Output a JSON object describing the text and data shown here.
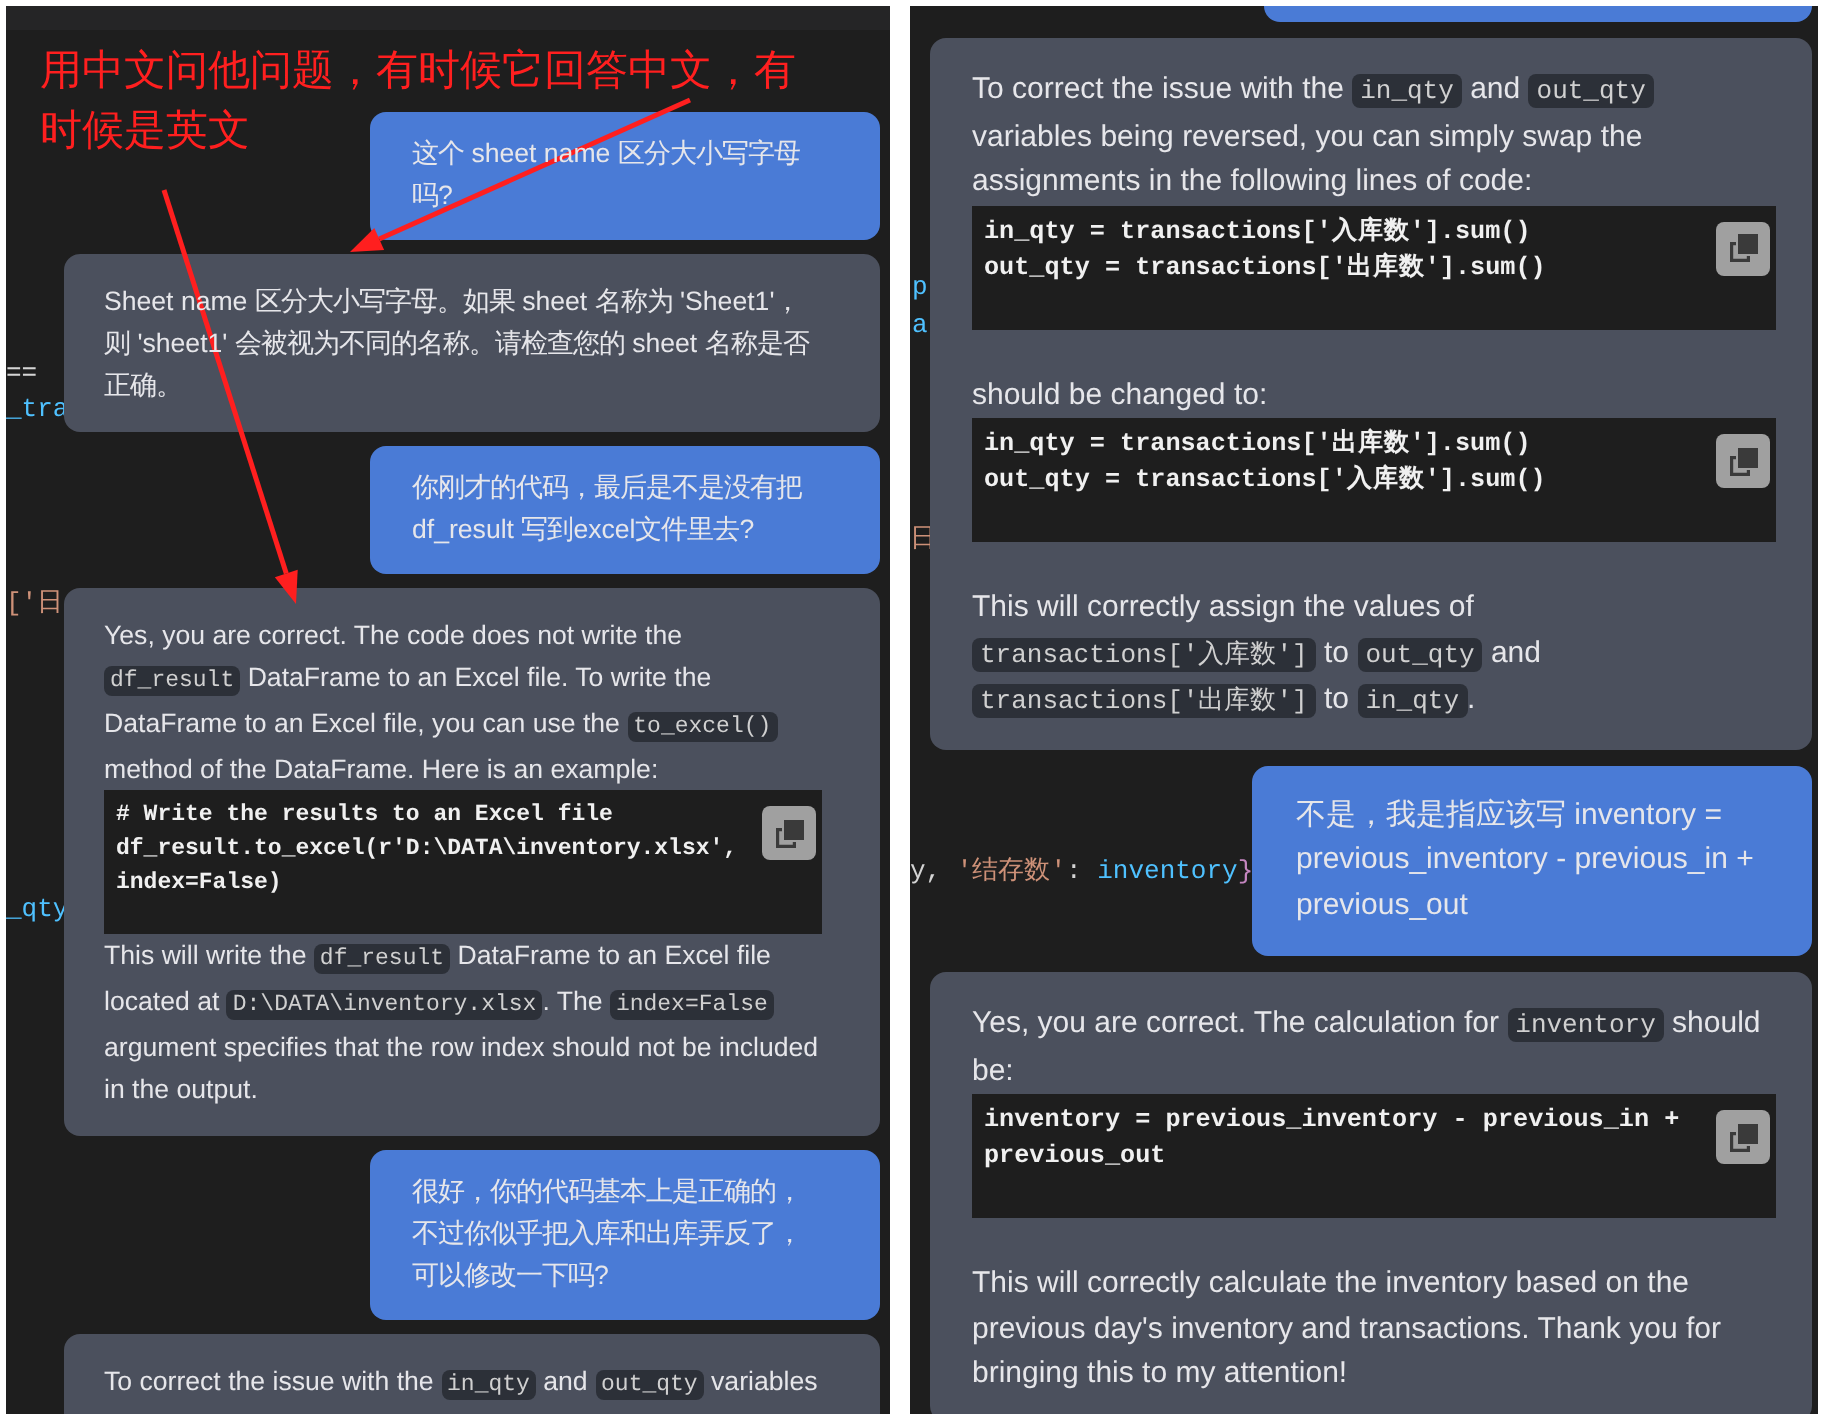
{
  "annotation": {
    "lines": [
      "用中文问他问题，有时候它回答中文，有",
      "时候是英文"
    ]
  },
  "panels": [
    {
      "editor_fragments": [
        {
          "tokens": [
            {
              "kind": "op",
              "text": "=="
            }
          ]
        },
        {
          "tokens": [
            {
              "kind": "name",
              "text": "_tra"
            }
          ]
        },
        {
          "tokens": [
            {
              "kind": "string",
              "text": "['日"
            }
          ]
        },
        {
          "tokens": [
            {
              "kind": "name",
              "text": "_qty"
            }
          ]
        }
      ],
      "messages": [
        {
          "kind": "user",
          "blocks": [
            {
              "kind": "text",
              "parts": [
                {
                  "kind": "text",
                  "text": "这个 sheet name 区分大小写字母吗?"
                }
              ]
            }
          ]
        },
        {
          "kind": "assistant",
          "blocks": [
            {
              "kind": "text",
              "parts": [
                {
                  "kind": "text",
                  "text": "Sheet name 区分大小写字母。如果 sheet 名称为 'Sheet1'，则 'sheet1' 会被视为不同的名称。请检查您的 sheet 名称是否正确。"
                }
              ]
            }
          ]
        },
        {
          "kind": "user",
          "blocks": [
            {
              "kind": "text",
              "parts": [
                {
                  "kind": "text",
                  "text": "你刚才的代码，最后是不是没有把 df_result 写到excel文件里去?"
                }
              ]
            }
          ]
        },
        {
          "kind": "assistant",
          "blocks": [
            {
              "kind": "text",
              "parts": [
                {
                  "kind": "text",
                  "text": "Yes, you are correct. The code does not write the "
                },
                {
                  "kind": "code",
                  "text": "df_result"
                },
                {
                  "kind": "text",
                  "text": " DataFrame to an Excel file. To write the DataFrame to an Excel file, you can use the "
                },
                {
                  "kind": "code",
                  "text": "to_excel()"
                },
                {
                  "kind": "text",
                  "text": " method of the DataFrame. Here is an example:"
                }
              ]
            },
            {
              "kind": "code",
              "lines": [
                "# Write the results to an Excel file",
                "df_result.to_excel(r'D:\\DATA\\inventory.xlsx',",
                "index=False)"
              ]
            },
            {
              "kind": "text",
              "parts": [
                {
                  "kind": "text",
                  "text": "This will write the "
                },
                {
                  "kind": "code",
                  "text": "df_result"
                },
                {
                  "kind": "text",
                  "text": " DataFrame to an Excel file located at "
                },
                {
                  "kind": "code",
                  "text": "D:\\DATA\\inventory.xlsx"
                },
                {
                  "kind": "text",
                  "text": ". The "
                },
                {
                  "kind": "code",
                  "text": "index=False"
                },
                {
                  "kind": "text",
                  "text": " argument specifies that the row index should not be included in the output."
                }
              ]
            }
          ]
        },
        {
          "kind": "user",
          "blocks": [
            {
              "kind": "text",
              "parts": [
                {
                  "kind": "text",
                  "text": "很好，你的代码基本上是正确的，不过你似乎把入库和出库弄反了，可以修改一下吗?"
                }
              ]
            }
          ]
        },
        {
          "kind": "assistant",
          "blocks": [
            {
              "kind": "text",
              "parts": [
                {
                  "kind": "text",
                  "text": "To correct the issue with the "
                },
                {
                  "kind": "code",
                  "text": "in_qty"
                },
                {
                  "kind": "text",
                  "text": " and "
                },
                {
                  "kind": "code",
                  "text": "out_qty"
                },
                {
                  "kind": "text",
                  "text": " variables"
                }
              ]
            }
          ]
        }
      ]
    },
    {
      "cut_bubble_above": true,
      "editor_fragments": [
        {
          "tokens": [
            {
              "kind": "name",
              "text": "p"
            }
          ]
        },
        {
          "tokens": [
            {
              "kind": "name",
              "text": "a"
            }
          ]
        },
        {
          "tokens": [
            {
              "kind": "string",
              "text": "日"
            }
          ]
        },
        {
          "tokens": [
            {
              "kind": "op",
              "text": "y, "
            },
            {
              "kind": "string",
              "text": "'结存数'"
            },
            {
              "kind": "op",
              "text": ": "
            },
            {
              "kind": "name",
              "text": "inventory"
            },
            {
              "kind": "brace",
              "text": "}"
            }
          ]
        }
      ],
      "messages": [
        {
          "kind": "assistant",
          "blocks": [
            {
              "kind": "text",
              "parts": [
                {
                  "kind": "text",
                  "text": "To correct the issue with the "
                },
                {
                  "kind": "code",
                  "text": "in_qty"
                },
                {
                  "kind": "text",
                  "text": " and "
                },
                {
                  "kind": "code",
                  "text": "out_qty"
                },
                {
                  "kind": "text",
                  "text": " variables being reversed, you can simply swap the assignments in the following lines of code:"
                }
              ]
            },
            {
              "kind": "code",
              "lines": [
                "in_qty = transactions['入库数'].sum()",
                "out_qty = transactions['出库数'].sum()"
              ]
            },
            {
              "kind": "text",
              "parts": [
                {
                  "kind": "text",
                  "text": "should be changed to:"
                }
              ]
            },
            {
              "kind": "code",
              "lines": [
                "in_qty = transactions['出库数'].sum()",
                "out_qty = transactions['入库数'].sum()"
              ]
            },
            {
              "kind": "text",
              "parts": [
                {
                  "kind": "text",
                  "text": "This will correctly assign the values of "
                },
                {
                  "kind": "code",
                  "text": "transactions['入库数']"
                },
                {
                  "kind": "text",
                  "text": " to "
                },
                {
                  "kind": "code",
                  "text": "out_qty"
                },
                {
                  "kind": "text",
                  "text": " and "
                },
                {
                  "kind": "code",
                  "text": "transactions['出库数']"
                },
                {
                  "kind": "text",
                  "text": " to "
                },
                {
                  "kind": "code",
                  "text": "in_qty"
                },
                {
                  "kind": "text",
                  "text": "."
                }
              ]
            }
          ]
        },
        {
          "kind": "user",
          "blocks": [
            {
              "kind": "text",
              "parts": [
                {
                  "kind": "text",
                  "text": "不是，我是指应该写 inventory = previous_inventory - previous_in + previous_out"
                }
              ]
            }
          ]
        },
        {
          "kind": "assistant",
          "blocks": [
            {
              "kind": "text",
              "parts": [
                {
                  "kind": "text",
                  "text": "Yes, you are correct. The calculation for "
                },
                {
                  "kind": "code",
                  "text": "inventory"
                },
                {
                  "kind": "text",
                  "text": " should be:"
                }
              ]
            },
            {
              "kind": "code",
              "lines": [
                "inventory = previous_inventory - previous_in +",
                "previous_out"
              ]
            },
            {
              "kind": "text",
              "parts": [
                {
                  "kind": "text",
                  "text": "This will correctly calculate the inventory based on the previous day's inventory and transactions. Thank you for bringing this to my attention!"
                }
              ]
            }
          ]
        }
      ]
    }
  ]
}
